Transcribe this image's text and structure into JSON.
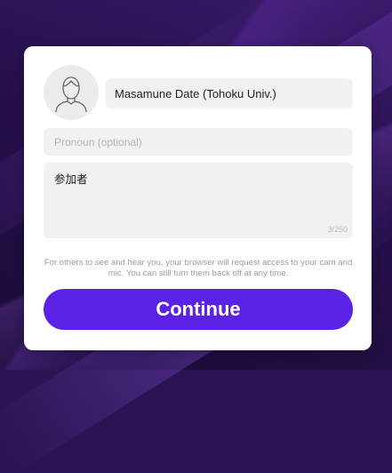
{
  "profile": {
    "avatar_icon": "user-outline-icon",
    "name_value": "Masamune Date (Tohoku Univ.)",
    "pronoun_placeholder": "Pronoun (optional)",
    "bio_value": "参加者",
    "bio_char_count": "3/250"
  },
  "notice": {
    "text": "For others to see and hear you, your browser will request access to your cam and mic. You can still turn them back off at any time."
  },
  "actions": {
    "continue_label": "Continue"
  },
  "colors": {
    "accent": "#5b22e6",
    "background": "#2a1552",
    "field": "#f1f1f1"
  }
}
